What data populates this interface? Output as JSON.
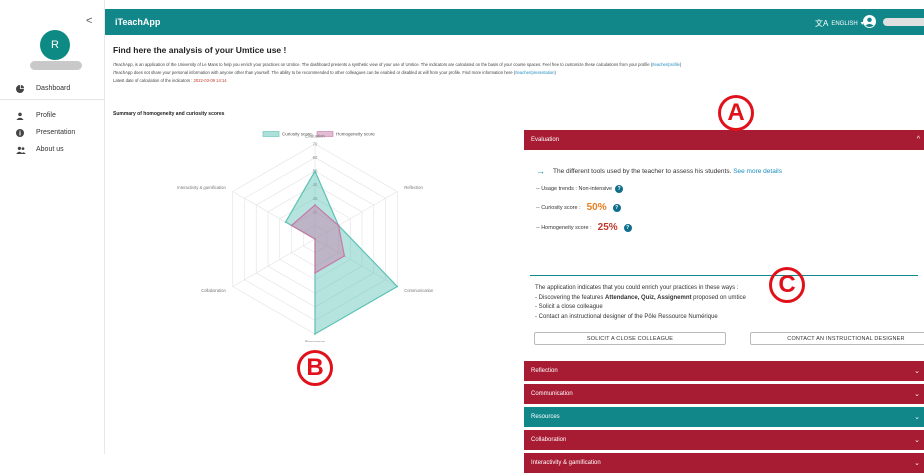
{
  "sidebar": {
    "collapse_icon": "chevron-left-icon",
    "avatar_initial": "R",
    "items": [
      {
        "label": "Dashboard",
        "icon": "pie-chart-icon"
      },
      {
        "label": "Profile",
        "icon": "person-icon"
      },
      {
        "label": "Presentation",
        "icon": "info-icon"
      },
      {
        "label": "About us",
        "icon": "group-icon"
      }
    ]
  },
  "header": {
    "app_title": "iTeachApp",
    "language": "ENGLISH",
    "colors": {
      "teal": "#12878a",
      "crimson": "#a71b33"
    }
  },
  "main": {
    "title": "Find here the analysis of your Umtice use !",
    "para1": "iTeachApp, is an application of the University of Le Mans to help you enrich your practices on Umtice. The dashboard presents a synthetic view of your use of Umtice. The indicators are calculated on the basis of your course spaces. Feel free to customize these calculations from your profile (",
    "para1_link": "/teacher/profile",
    "para1_end": ")",
    "para2": "iTeachApp does not share your personal information with anyone other than yourself. The ability to be recommended to other colleagues can be enabled or disabled at will from your profile. Find more information here (",
    "para2_link": "/teacher/presentation",
    "para2_end": ")",
    "date_label": "Latest date of calculation of the indicators :",
    "date_value": "2022-03-09 14:14",
    "summary_title": "Summary of homogeneity and curiosity scores"
  },
  "chart_data": {
    "type": "radar",
    "axes": [
      "Evaluation",
      "Reflection",
      "Communication",
      "Resources",
      "Collaboration",
      "Interactivity & gamification"
    ],
    "ticks": [
      20,
      30,
      40,
      50,
      60,
      70
    ],
    "rmax": 70,
    "series": [
      {
        "name": "Curiosity score",
        "color": "#5cc2b5",
        "values": [
          50,
          20,
          70,
          70,
          0,
          25
        ]
      },
      {
        "name": "Homogeneity score",
        "color": "#c77aa8",
        "values": [
          25,
          20,
          25,
          25,
          0,
          20
        ]
      }
    ]
  },
  "panel": {
    "evaluation": {
      "title": "Evaluation",
      "tools_text": "The different tools used by the teacher to assess his students.",
      "more_link": "See more details",
      "usage_label": "-- Usage trends : Non-intensive",
      "curiosity_label": "-- Curiosity score :",
      "curiosity_value": "50%",
      "homogeneity_label": "-- Homogeneity score :",
      "homogeneity_value": "25%",
      "advice_intro": "The application indicates that you could enrich your practices in these ways :",
      "advice_1_pre": "- Discovering the features ",
      "advice_1_bold": "Attendance, Quiz, Assignemnt",
      "advice_1_post": " proposed on umtice",
      "advice_2": "- Solicit a close colleague",
      "advice_3": "- Contact an instructional designer of the Pôle Ressource Numérique",
      "btn_colleague": "SOLICIT A CLOSE COLLEAGUE",
      "btn_designer": "CONTACT AN INSTRUCTIONAL DESIGNER"
    },
    "sections": [
      {
        "title": "Reflection",
        "color": "crimson"
      },
      {
        "title": "Communication",
        "color": "crimson"
      },
      {
        "title": "Resources",
        "color": "teal"
      },
      {
        "title": "Collaboration",
        "color": "crimson"
      },
      {
        "title": "Interactivity & gamification",
        "color": "crimson"
      }
    ]
  },
  "callouts": {
    "a": "A",
    "b": "B",
    "c": "C"
  }
}
